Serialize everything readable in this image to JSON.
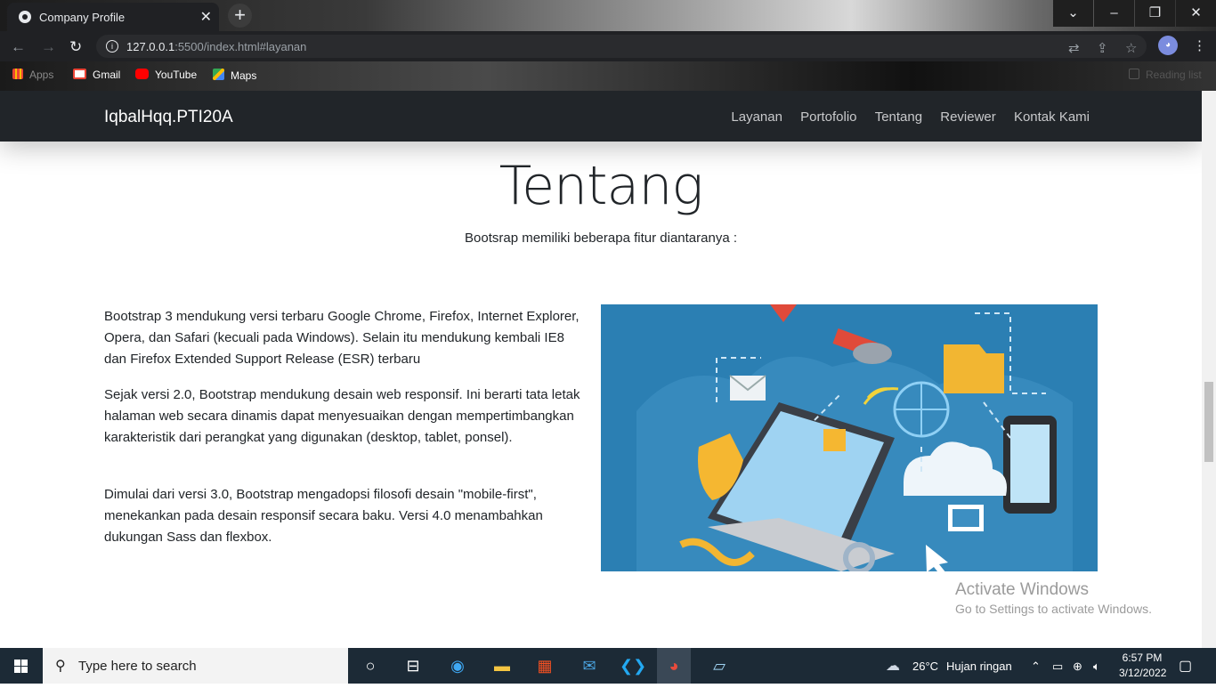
{
  "browser": {
    "tab_title": "Company Profile",
    "tab_close": "✕",
    "new_tab": "+",
    "url_host": "127.0.0.1",
    "url_rest": ":5500/index.html#layanan",
    "bookmarks": [
      {
        "label": "Apps"
      },
      {
        "label": "Gmail"
      },
      {
        "label": "YouTube"
      },
      {
        "label": "Maps"
      }
    ],
    "reading_list": "Reading list"
  },
  "site": {
    "brand": "IqbalHqq.PTI20A",
    "menu": [
      "Layanan",
      "Portofolio",
      "Tentang",
      "Reviewer",
      "Kontak Kami"
    ],
    "heading": "Tentang",
    "subheading": "Bootsrap memiliki beberapa fitur diantaranya :",
    "paragraphs": [
      "Bootstrap 3 mendukung versi terbaru Google Chrome, Firefox, Internet Explorer, Opera, dan Safari (kecuali pada Windows). Selain itu mendukung kembali IE8 dan Firefox Extended Support Release (ESR) terbaru",
      "Sejak versi 2.0, Bootstrap mendukung desain web responsif. Ini berarti tata letak halaman web secara dinamis dapat menyesuaikan dengan mempertimbangkan karakteristik dari perangkat yang digunakan (desktop, tablet, ponsel).",
      "Dimulai dari versi 3.0, Bootstrap mengadopsi filosofi desain \"mobile-first\", menekankan pada desain responsif secara baku. Versi 4.0 menambahkan dukungan Sass dan flexbox."
    ]
  },
  "watermark": {
    "title": "Activate Windows",
    "subtitle": "Go to Settings to activate Windows."
  },
  "taskbar": {
    "search_placeholder": "Type here to search",
    "weather_temp": "26°C",
    "weather_desc": "Hujan ringan",
    "time": "6:57 PM",
    "date": "3/12/2022"
  },
  "colors": {
    "navbar_bg": "#212529",
    "image_bg": "#2b7fb3",
    "taskbar_bg": "#1c2a36"
  }
}
